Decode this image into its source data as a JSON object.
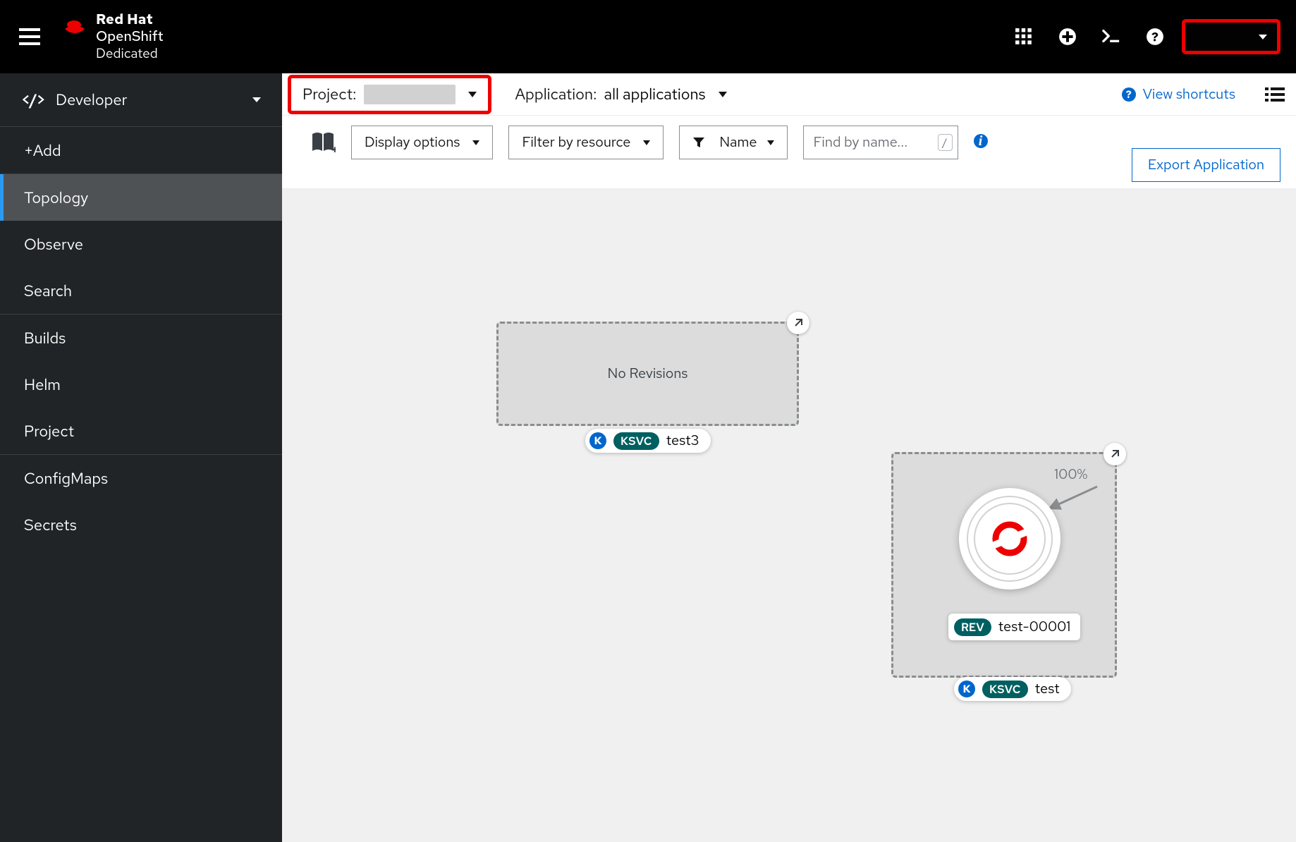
{
  "brand": {
    "line1": "Red Hat",
    "line2": "OpenShift",
    "line3": "Dedicated"
  },
  "perspective": "Developer",
  "nav": {
    "add": "+Add",
    "topology": "Topology",
    "observe": "Observe",
    "search": "Search",
    "builds": "Builds",
    "helm": "Helm",
    "project": "Project",
    "configmaps": "ConfigMaps",
    "secrets": "Secrets"
  },
  "projectBar": {
    "projectLabel": "Project:",
    "projectValue": "",
    "appLabel": "Application:",
    "appValue": "all applications",
    "shortcuts": "View shortcuts"
  },
  "toolbar": {
    "displayOptions": "Display options",
    "filterByResource": "Filter by resource",
    "name": "Name",
    "find_placeholder": "Find by name...",
    "keyhint": "/",
    "export": "Export Application"
  },
  "topology": {
    "noRevisions": "No Revisions",
    "ksvcBadge": "KSVC",
    "kSymbol": "K",
    "revBadge": "REV",
    "trafficPct": "100%",
    "service1Name": "test3",
    "service2Name": "test",
    "revisionName": "test-00001"
  }
}
